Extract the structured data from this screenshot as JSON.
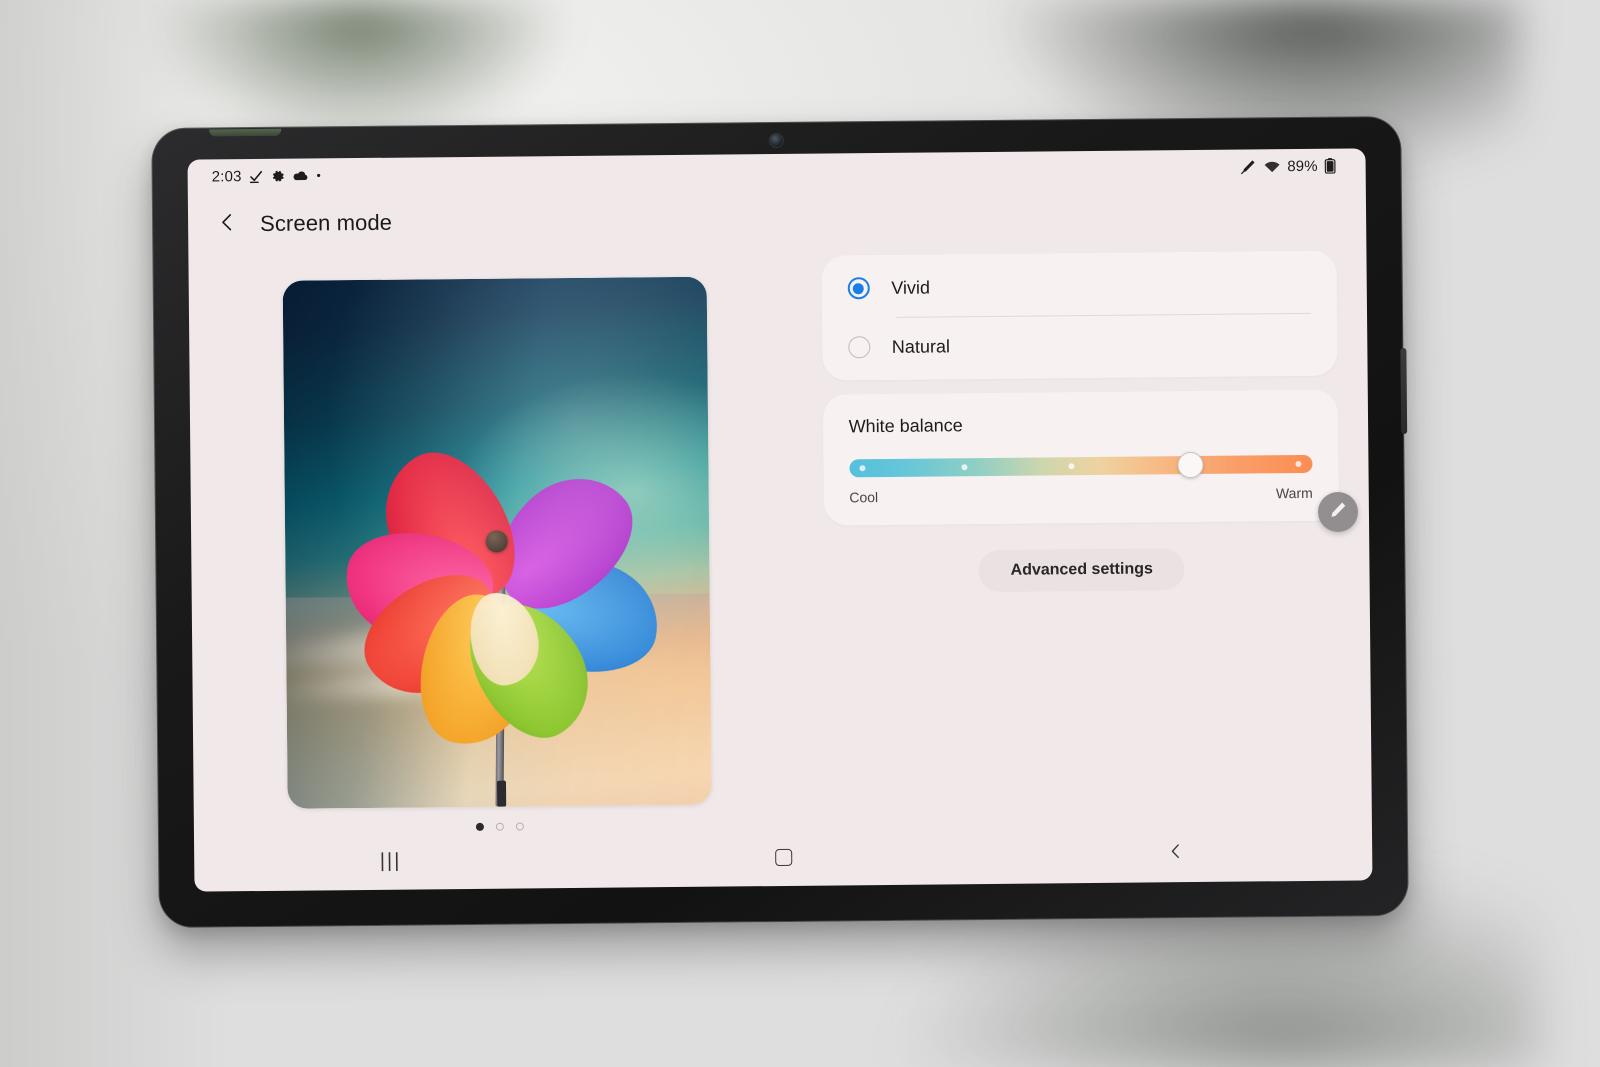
{
  "device": {
    "name": "tablet",
    "camera_icon": "front-camera"
  },
  "status_bar": {
    "clock": "2:03",
    "left_icons": [
      "check-mark-icon",
      "gear-icon",
      "cloud-icon",
      "dot-icon"
    ],
    "right_icons": [
      "stylus-icon",
      "wifi-icon",
      "battery-icon"
    ],
    "battery_text": "89%"
  },
  "header": {
    "back_icon": "chevron-left-icon",
    "title": "Screen mode"
  },
  "preview": {
    "alt": "colorful pinwheel against sunset sky wallpaper",
    "dots": [
      {
        "state": "active"
      },
      {
        "state": "inactive"
      },
      {
        "state": "inactive"
      }
    ]
  },
  "screen_mode": {
    "options": [
      {
        "label": "Vivid",
        "selected": true
      },
      {
        "label": "Natural",
        "selected": false
      }
    ]
  },
  "white_balance": {
    "title": "White balance",
    "cool_label": "Cool",
    "warm_label": "Warm",
    "value_percent": 73.6,
    "tick_positions": [
      3,
      25,
      48,
      97
    ],
    "gradient_cool": "#55c0dd",
    "gradient_warm": "#fb8d52"
  },
  "advanced": {
    "label": "Advanced settings"
  },
  "nav_bar": {
    "recents_glyph": "|||",
    "recents_name": "recents-icon",
    "home_name": "home-icon",
    "back_glyph": "‹",
    "back_name": "back-icon"
  },
  "spen": {
    "icon": "pen-icon"
  },
  "colors": {
    "accent_blue": "#1a7ee8",
    "screen_bg": "#f1e9e9",
    "card_bg": "#f7f1f1",
    "button_bg": "#eae2e2",
    "text_primary": "#1d1b1b"
  }
}
